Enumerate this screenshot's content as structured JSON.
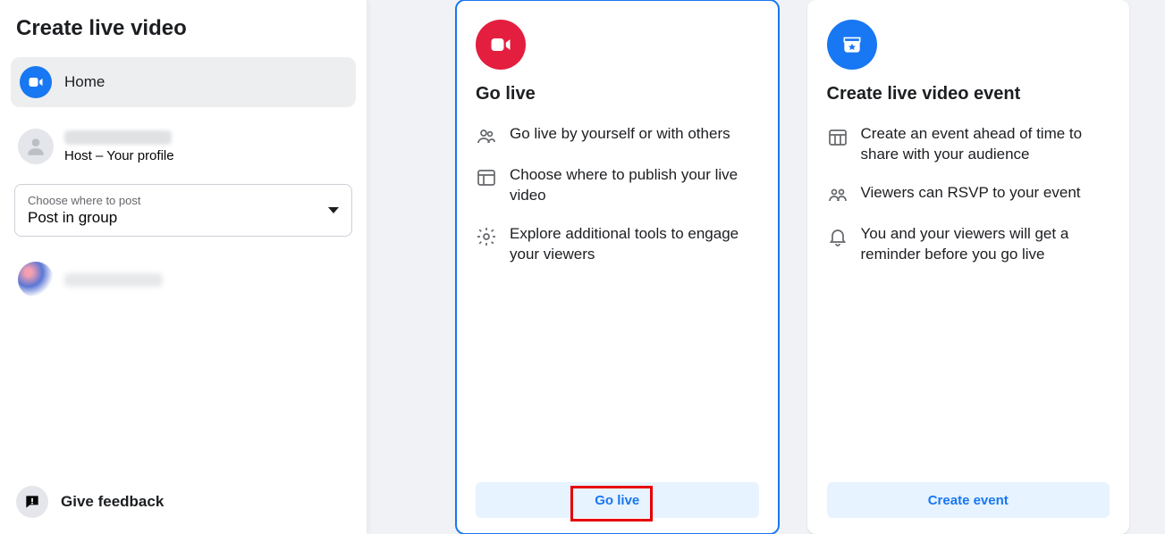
{
  "sidebar": {
    "title": "Create live video",
    "nav_home_label": "Home",
    "host_subtitle": "Host – Your profile",
    "post_select_label": "Choose where to post",
    "post_select_value": "Post in group",
    "feedback_label": "Give feedback"
  },
  "cards": {
    "go_live": {
      "title": "Go live",
      "features": [
        "Go live by yourself or with others",
        "Choose where to publish your live video",
        "Explore additional tools to engage your viewers"
      ],
      "action": "Go live"
    },
    "event": {
      "title": "Create live video event",
      "features": [
        "Create an event ahead of time to share with your audience",
        "Viewers can RSVP to your event",
        "You and your viewers will get a reminder before you go live"
      ],
      "action": "Create event"
    }
  }
}
